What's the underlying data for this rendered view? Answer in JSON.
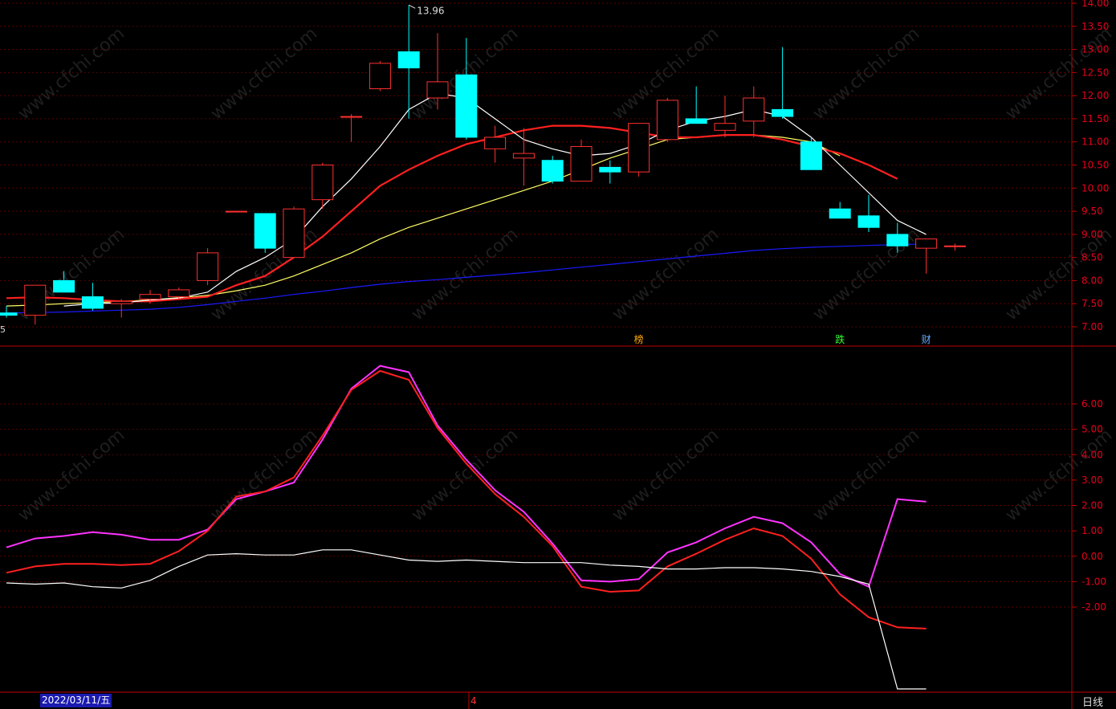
{
  "window": {
    "period": "日线",
    "current_date": "2022/03/11/五",
    "cursor_marker": "4",
    "left_edge_label": "5"
  },
  "colors": {
    "up": "#ff3030",
    "down": "#00ffff",
    "ma5": "#ffffff",
    "ma10": "#ff2020",
    "ma20": "#ffff66",
    "ma60": "#1a1aff",
    "axis": "#c00000",
    "macd_diff": "#ff2020",
    "macd_dea": "#ff33ff",
    "macd_white": "#ffffff"
  },
  "watermark": "www.cfchi.com",
  "chart_data": [
    {
      "type": "candlestick",
      "ylim": [
        6.8,
        14.06
      ],
      "yticks": [
        "14.00",
        "13.50",
        "13.00",
        "12.50",
        "12.00",
        "11.50",
        "11.00",
        "10.50",
        "10.00",
        "9.50",
        "9.00",
        "8.50",
        "8.00",
        "7.50",
        "7.00"
      ],
      "max_label": "13.96",
      "candles": [
        {
          "o": 7.3,
          "c": 7.25,
          "h": 7.45,
          "l": 7.2
        },
        {
          "o": 7.25,
          "c": 7.9,
          "h": 7.9,
          "l": 7.05
        },
        {
          "o": 8.0,
          "c": 7.75,
          "h": 8.2,
          "l": 7.75
        },
        {
          "o": 7.65,
          "c": 7.4,
          "h": 7.95,
          "l": 7.35
        },
        {
          "o": 7.5,
          "c": 7.55,
          "h": 7.6,
          "l": 7.2
        },
        {
          "o": 7.6,
          "c": 7.7,
          "h": 7.8,
          "l": 7.5
        },
        {
          "o": 7.65,
          "c": 7.8,
          "h": 7.85,
          "l": 7.6
        },
        {
          "o": 8.0,
          "c": 8.6,
          "h": 8.7,
          "l": 7.9
        },
        {
          "o": 9.5,
          "c": 9.5,
          "h": 9.5,
          "l": 9.5
        },
        {
          "o": 9.45,
          "c": 8.7,
          "h": 9.45,
          "l": 8.6
        },
        {
          "o": 8.5,
          "c": 9.55,
          "h": 9.6,
          "l": 8.5
        },
        {
          "o": 9.75,
          "c": 10.5,
          "h": 10.55,
          "l": 9.55
        },
        {
          "o": 11.55,
          "c": 11.55,
          "h": 11.6,
          "l": 11.0
        },
        {
          "o": 12.15,
          "c": 12.7,
          "h": 12.75,
          "l": 12.1
        },
        {
          "o": 12.95,
          "c": 12.6,
          "h": 13.96,
          "l": 11.5
        },
        {
          "o": 11.95,
          "c": 12.3,
          "h": 13.35,
          "l": 11.7
        },
        {
          "o": 12.45,
          "c": 11.1,
          "h": 13.25,
          "l": 11.05
        },
        {
          "o": 10.85,
          "c": 11.1,
          "h": 11.35,
          "l": 10.55
        },
        {
          "o": 10.65,
          "c": 10.75,
          "h": 11.3,
          "l": 10.05
        },
        {
          "o": 10.6,
          "c": 10.15,
          "h": 10.7,
          "l": 10.1
        },
        {
          "o": 10.15,
          "c": 10.9,
          "h": 11.05,
          "l": 10.15
        },
        {
          "o": 10.45,
          "c": 10.35,
          "h": 10.6,
          "l": 10.1
        },
        {
          "o": 10.35,
          "c": 11.4,
          "h": 11.4,
          "l": 10.25
        },
        {
          "o": 11.05,
          "c": 11.9,
          "h": 11.95,
          "l": 11.0
        },
        {
          "o": 11.5,
          "c": 11.4,
          "h": 12.2,
          "l": 11.4
        },
        {
          "o": 11.25,
          "c": 11.4,
          "h": 12.0,
          "l": 11.1
        },
        {
          "o": 11.45,
          "c": 11.95,
          "h": 12.2,
          "l": 11.1
        },
        {
          "o": 11.7,
          "c": 11.55,
          "h": 13.05,
          "l": 11.5
        },
        {
          "o": 11.0,
          "c": 10.4,
          "h": 11.1,
          "l": 10.4
        },
        {
          "o": 9.55,
          "c": 9.35,
          "h": 9.7,
          "l": 9.35
        },
        {
          "o": 9.4,
          "c": 9.15,
          "h": 9.85,
          "l": 9.05
        },
        {
          "o": 9.0,
          "c": 8.75,
          "h": 9.25,
          "l": 8.6
        },
        {
          "o": 8.7,
          "c": 8.9,
          "h": 8.9,
          "l": 8.15
        },
        {
          "o": 8.75,
          "c": 8.75,
          "h": 8.8,
          "l": 8.65
        }
      ],
      "ma5": [
        null,
        null,
        7.45,
        7.5,
        7.52,
        7.58,
        7.62,
        7.75,
        8.2,
        8.5,
        8.9,
        9.6,
        10.2,
        10.9,
        11.7,
        12.05,
        11.95,
        11.5,
        11.05,
        10.85,
        10.7,
        10.75,
        10.95,
        11.25,
        11.45,
        11.55,
        11.7,
        11.55,
        11.1,
        10.5,
        9.9,
        9.3,
        9.0
      ],
      "ma10": [
        7.62,
        7.64,
        7.62,
        7.58,
        7.55,
        7.55,
        7.6,
        7.65,
        7.9,
        8.1,
        8.5,
        8.95,
        9.5,
        10.05,
        10.4,
        10.7,
        10.95,
        11.1,
        11.25,
        11.35,
        11.35,
        11.3,
        11.2,
        11.1,
        11.1,
        11.15,
        11.15,
        11.05,
        10.9,
        10.75,
        10.5,
        10.2
      ],
      "ma20": [
        7.45,
        7.47,
        7.5,
        7.52,
        7.55,
        7.58,
        7.63,
        7.68,
        7.78,
        7.9,
        8.1,
        8.35,
        8.6,
        8.9,
        9.15,
        9.35,
        9.55,
        9.75,
        9.95,
        10.15,
        10.4,
        10.65,
        10.85,
        11.05,
        11.1,
        11.15,
        11.15,
        11.1,
        11.0,
        10.7
      ],
      "ma60": [
        7.3,
        7.31,
        7.32,
        7.34,
        7.36,
        7.38,
        7.42,
        7.48,
        7.55,
        7.62,
        7.7,
        7.77,
        7.85,
        7.92,
        7.98,
        8.02,
        8.07,
        8.12,
        8.17,
        8.23,
        8.29,
        8.35,
        8.41,
        8.47,
        8.53,
        8.59,
        8.65,
        8.69,
        8.72,
        8.74,
        8.76,
        8.78,
        8.79
      ],
      "flags": [
        {
          "text": "榜",
          "index": 22,
          "color": "#ffaa00"
        },
        {
          "text": "跌",
          "index": 29,
          "color": "#33ff33"
        },
        {
          "text": "财",
          "index": 32,
          "color": "#66aaff"
        }
      ]
    },
    {
      "type": "line",
      "ylim": [
        -3.0,
        7.0
      ],
      "yticks": [
        "6.00",
        "5.00",
        "4.00",
        "3.00",
        "2.00",
        "1.00",
        "0.00",
        "-1.00",
        "-2.00"
      ],
      "series": [
        {
          "key": "dea",
          "values": [
            0.35,
            0.7,
            0.8,
            0.95,
            0.85,
            0.65,
            0.65,
            1.05,
            2.25,
            2.55,
            2.9,
            4.6,
            6.6,
            7.5,
            7.25,
            5.15,
            3.8,
            2.6,
            1.75,
            0.5,
            -0.95,
            -1.0,
            -0.9,
            0.15,
            0.55,
            1.1,
            1.55,
            1.3,
            0.55,
            -0.7,
            -1.2,
            2.25,
            2.15
          ]
        },
        {
          "key": "diff",
          "values": [
            -0.65,
            -0.4,
            -0.3,
            -0.3,
            -0.35,
            -0.3,
            0.2,
            1.0,
            2.35,
            2.55,
            3.1,
            4.75,
            6.55,
            7.3,
            6.95,
            5.05,
            3.65,
            2.45,
            1.55,
            0.4,
            -1.2,
            -1.4,
            -1.35,
            -0.4,
            0.1,
            0.65,
            1.1,
            0.8,
            -0.1,
            -1.5,
            -2.4,
            -2.8,
            -2.85
          ]
        },
        {
          "key": "white",
          "values": [
            -1.05,
            -1.1,
            -1.05,
            -1.2,
            -1.25,
            -0.95,
            -0.4,
            0.05,
            0.1,
            0.05,
            0.05,
            0.25,
            0.25,
            0.05,
            -0.15,
            -0.2,
            -0.15,
            -0.2,
            -0.25,
            -0.25,
            -0.25,
            -0.35,
            -0.4,
            -0.5,
            -0.5,
            -0.45,
            -0.45,
            -0.5,
            -0.6,
            -0.8,
            -1.1,
            -5.3,
            -5.3
          ]
        }
      ]
    }
  ]
}
